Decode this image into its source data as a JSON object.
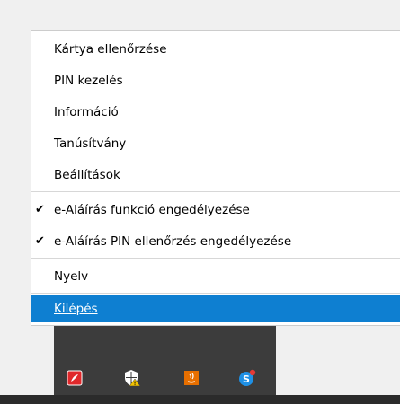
{
  "menu": {
    "items": [
      {
        "label": "Kártya ellenőrzése"
      },
      {
        "label": "PIN kezelés"
      },
      {
        "label": "Információ"
      },
      {
        "label": "Tanúsítvány"
      },
      {
        "label": "Beállítások"
      },
      {
        "label": "e-Aláírás funkció engedélyezése",
        "check": "✔"
      },
      {
        "label": "e-Aláírás PIN ellenőrzés engedélyezése",
        "check": "✔"
      },
      {
        "label": "Nyelv"
      },
      {
        "label": "Kilépés"
      }
    ]
  },
  "tray": {
    "icons": [
      "pdf-reader-icon",
      "security-warning-icon",
      "java-icon",
      "skype-icon"
    ]
  },
  "colors": {
    "highlight": "#0e7fd1",
    "tray": "#3c3c3c",
    "taskbar": "#2b2b2b"
  }
}
